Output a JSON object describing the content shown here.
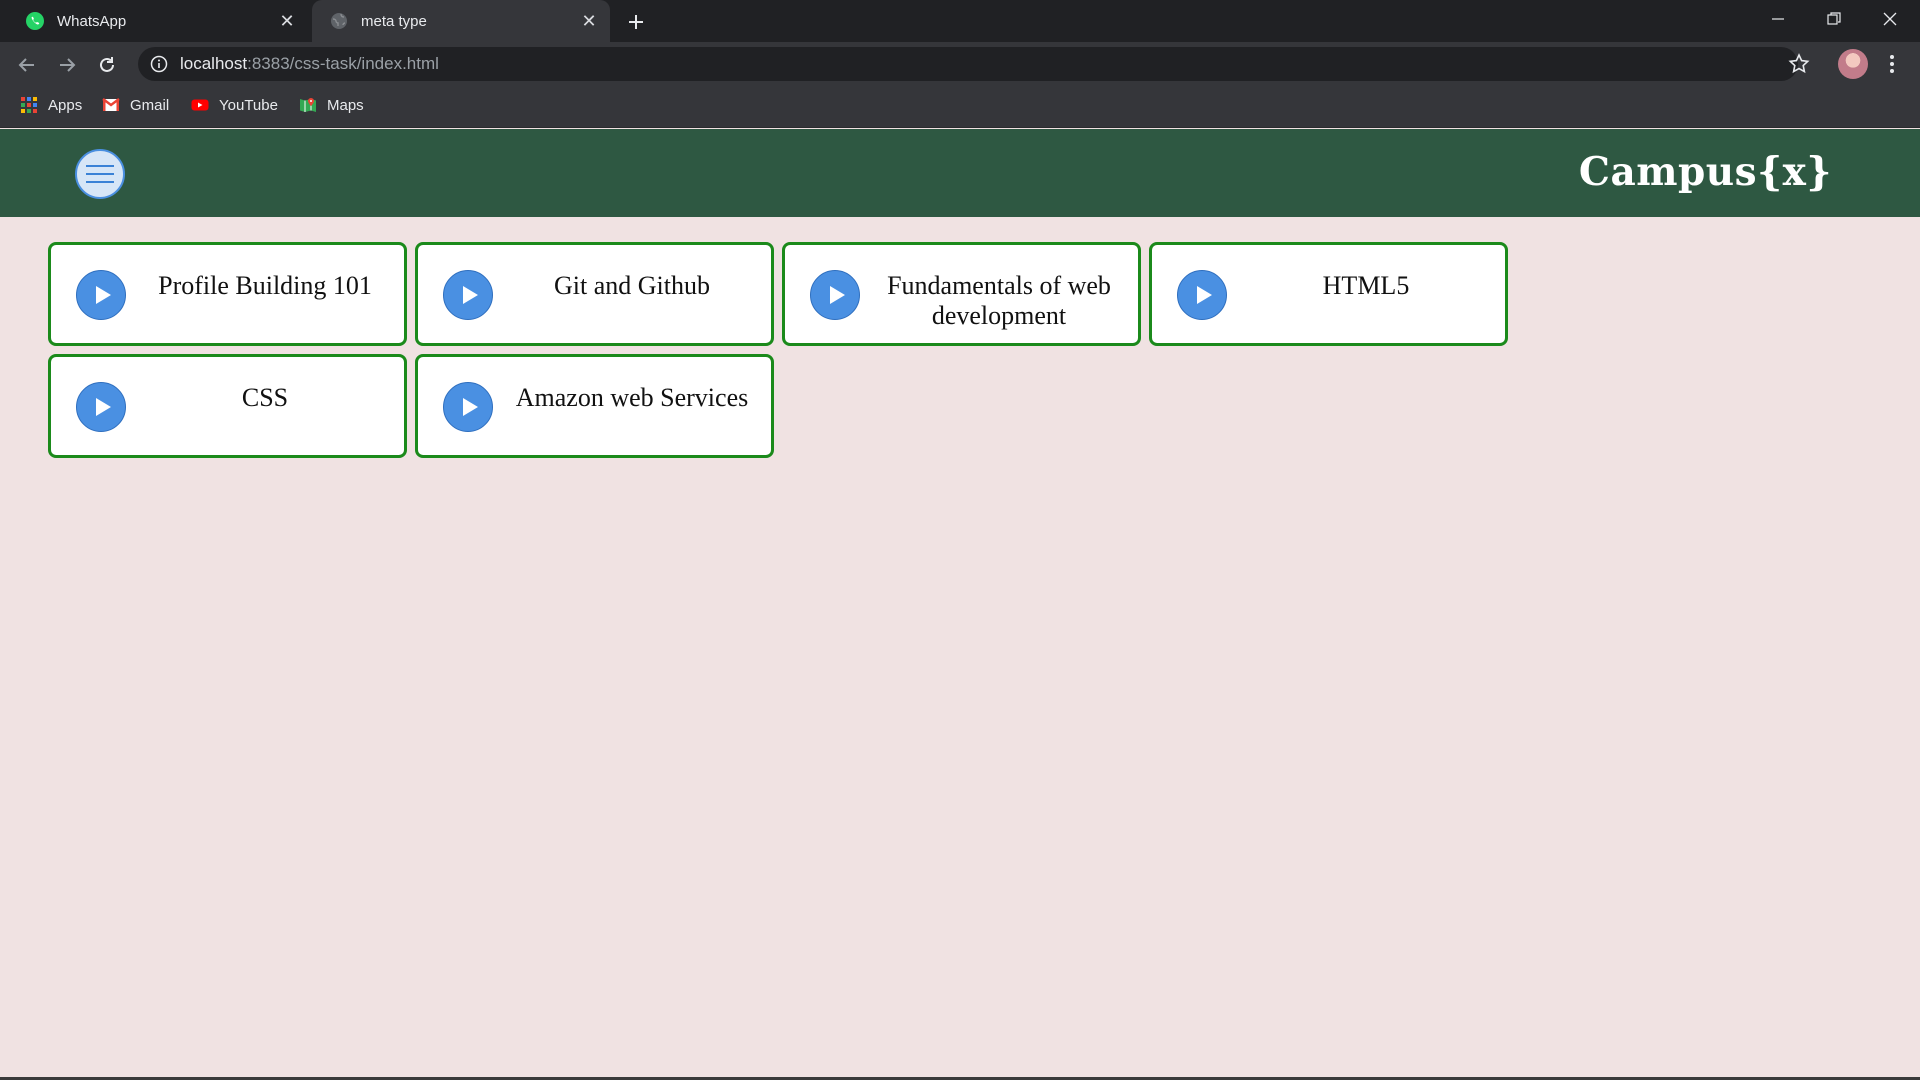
{
  "browser": {
    "tabs": [
      {
        "title": "WhatsApp",
        "icon": "whatsapp-icon",
        "active": false
      },
      {
        "title": "meta type",
        "icon": "globe-icon",
        "active": true
      }
    ],
    "address": {
      "host": "localhost",
      "rest": ":8383/css-task/index.html"
    },
    "bookmarks": [
      {
        "label": "Apps",
        "icon": "apps-grid-icon"
      },
      {
        "label": "Gmail",
        "icon": "gmail-icon"
      },
      {
        "label": "YouTube",
        "icon": "youtube-icon"
      },
      {
        "label": "Maps",
        "icon": "maps-icon"
      }
    ]
  },
  "page": {
    "brand": "Campus{x}",
    "colors": {
      "navbar": "#2e5842",
      "background": "#f0e2e2",
      "card_border": "#1b8a1b",
      "play": "#4a90e2"
    },
    "cards": [
      {
        "title": "Profile Building 101"
      },
      {
        "title": "Git and Github"
      },
      {
        "title": "Fundamentals of web development"
      },
      {
        "title": "HTML5"
      },
      {
        "title": "CSS"
      },
      {
        "title": "Amazon web Services"
      }
    ]
  }
}
